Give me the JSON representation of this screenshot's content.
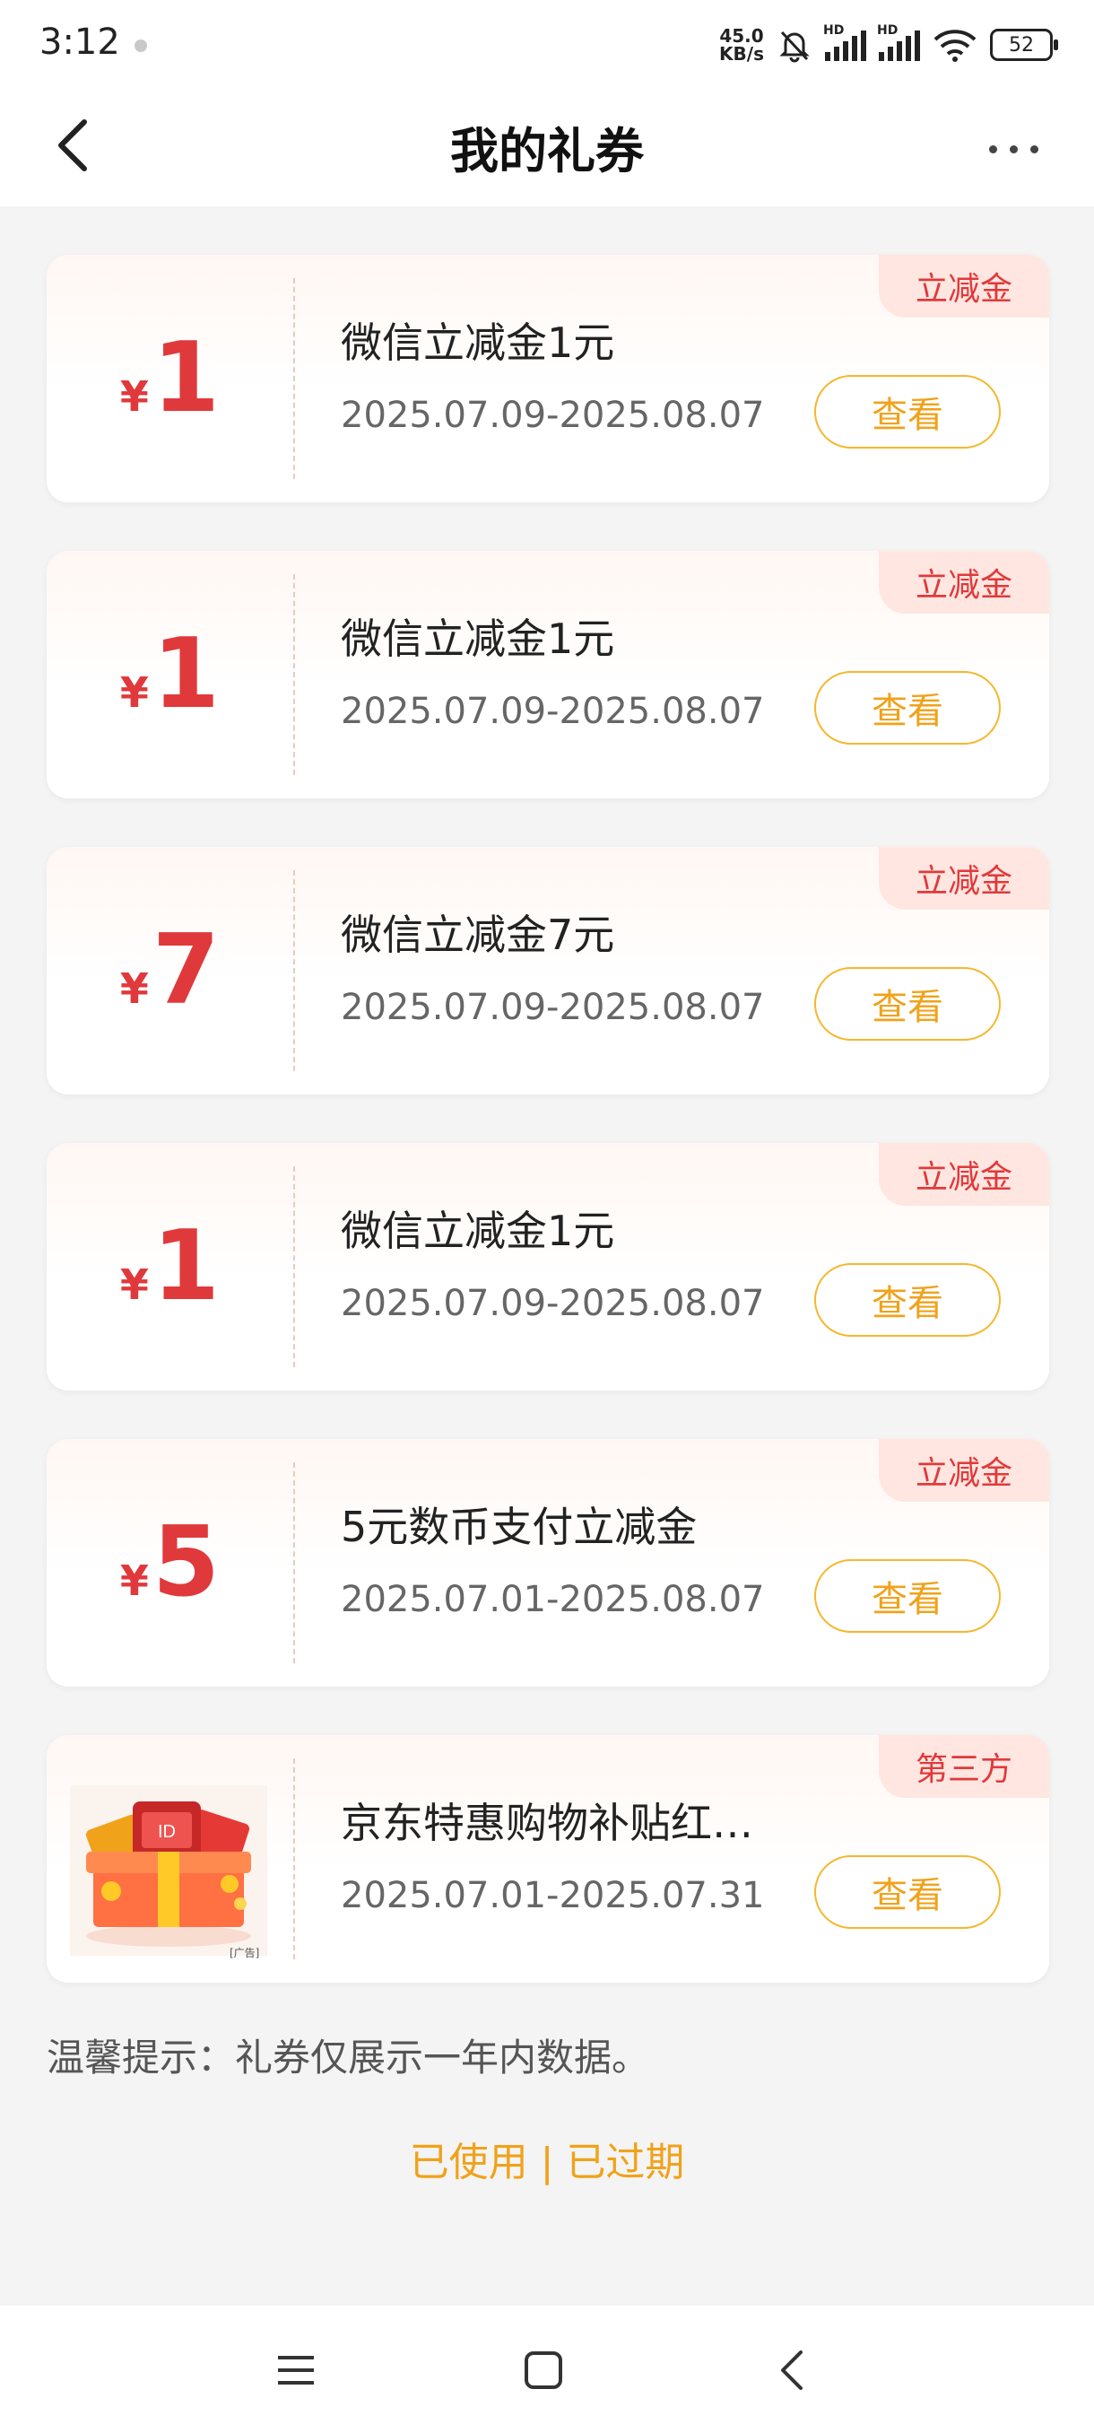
{
  "status_bar": {
    "time": "3:12",
    "net_speed_value": "45.0",
    "net_speed_unit": "KB/s",
    "hd_label": "HD",
    "battery": "52"
  },
  "header": {
    "title": "我的礼券"
  },
  "coupons": [
    {
      "symbol": "¥",
      "amount": "1",
      "title": "微信立减金1元",
      "date_range": "2025.07.09-2025.08.07",
      "tag": "立减金",
      "button": "查看"
    },
    {
      "symbol": "¥",
      "amount": "1",
      "title": "微信立减金1元",
      "date_range": "2025.07.09-2025.08.07",
      "tag": "立减金",
      "button": "查看"
    },
    {
      "symbol": "¥",
      "amount": "7",
      "title": "微信立减金7元",
      "date_range": "2025.07.09-2025.08.07",
      "tag": "立减金",
      "button": "查看"
    },
    {
      "symbol": "¥",
      "amount": "1",
      "title": "微信立减金1元",
      "date_range": "2025.07.09-2025.08.07",
      "tag": "立减金",
      "button": "查看"
    },
    {
      "symbol": "¥",
      "amount": "5",
      "title": "5元数币支付立减金",
      "date_range": "2025.07.01-2025.08.07",
      "tag": "立减金",
      "button": "查看"
    },
    {
      "title": "京东特惠购物补贴红…",
      "date_range": "2025.07.01-2025.07.31",
      "tag": "第三方",
      "button": "查看",
      "image_badge": "[广告]"
    }
  ],
  "tip": "温馨提示：礼券仅展示一年内数据。",
  "history_links": {
    "used": "已使用",
    "separator": "|",
    "expired": "已过期"
  },
  "colors": {
    "accent_red": "#e0393b",
    "button_orange": "#f0a21a",
    "tag_bg": "#ffe6e0"
  }
}
